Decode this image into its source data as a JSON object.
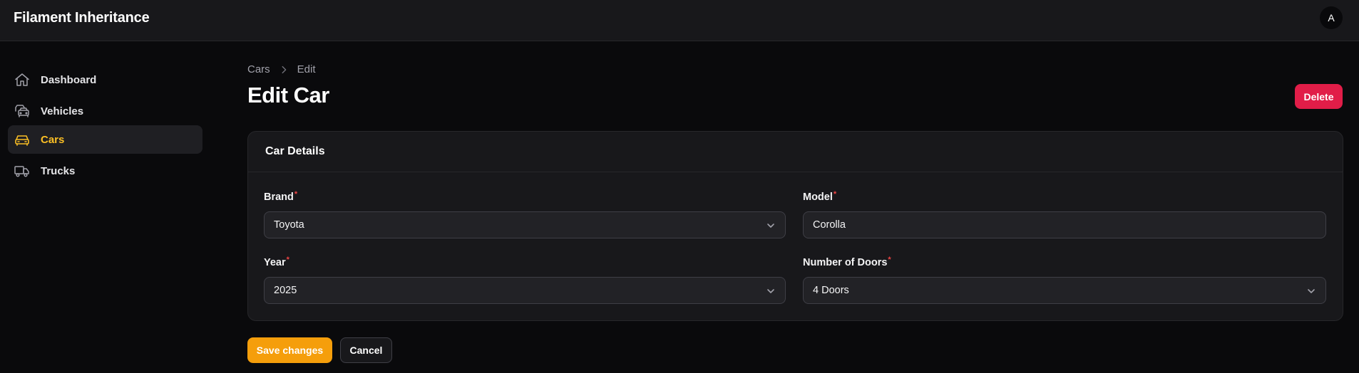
{
  "app": {
    "title": "Filament Inheritance",
    "avatar_initial": "A"
  },
  "sidebar": {
    "items": [
      {
        "label": "Dashboard",
        "icon": "home-icon",
        "active": false
      },
      {
        "label": "Vehicles",
        "icon": "vehicles-icon",
        "active": false
      },
      {
        "label": "Cars",
        "icon": "car-icon",
        "active": true
      },
      {
        "label": "Trucks",
        "icon": "truck-icon",
        "active": false
      }
    ]
  },
  "breadcrumb": {
    "items": [
      "Cars",
      "Edit"
    ]
  },
  "page": {
    "title": "Edit Car",
    "delete_label": "Delete"
  },
  "form": {
    "section_title": "Car Details",
    "fields": {
      "brand": {
        "label": "Brand",
        "value": "Toyota",
        "required": true,
        "type": "select"
      },
      "model": {
        "label": "Model",
        "value": "Corolla",
        "required": true,
        "type": "text"
      },
      "year": {
        "label": "Year",
        "value": "2025",
        "required": true,
        "type": "select"
      },
      "doors": {
        "label": "Number of Doors",
        "value": "4 Doors",
        "required": true,
        "type": "select"
      }
    },
    "required_marker": "*"
  },
  "actions": {
    "save_label": "Save changes",
    "cancel_label": "Cancel"
  },
  "colors": {
    "accent": "#f59e0b",
    "active_nav": "#fbbf24",
    "danger": "#e11d48",
    "required": "#ef4444",
    "background": "#0a0a0c",
    "surface": "#18181b"
  }
}
